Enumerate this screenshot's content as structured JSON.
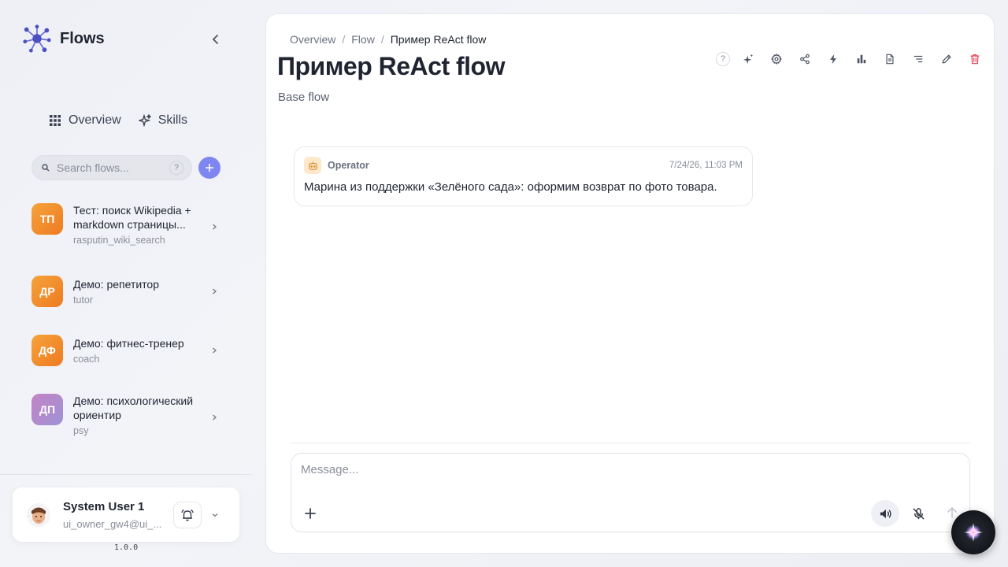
{
  "app": {
    "name": "Flows",
    "version": "1.0.0"
  },
  "nav": {
    "tabs": [
      {
        "label": "Overview",
        "icon": "grid-icon"
      },
      {
        "label": "Skills",
        "icon": "sparkles-icon"
      }
    ]
  },
  "search": {
    "placeholder": "Search flows...",
    "help": "?"
  },
  "flows": [
    {
      "initials": "ТП",
      "title": "Тест: поиск Wikipedia + markdown страницы...",
      "slug": "rasputin_wiki_search",
      "color": "#f08a2c"
    },
    {
      "initials": "ДР",
      "title": "Демо: репетитор",
      "slug": "tutor",
      "color": "#f08a2c"
    },
    {
      "initials": "ДФ",
      "title": "Демо: фитнес-тренер",
      "slug": "coach",
      "color": "#f08a2c"
    },
    {
      "initials": "ДП",
      "title": "Демо: психологический ориентир",
      "slug": "psy",
      "color": "#b589c9"
    }
  ],
  "user": {
    "name": "System User 1",
    "email": "ui_owner_gw4@ui_..."
  },
  "breadcrumb": {
    "items": [
      "Overview",
      "Flow"
    ],
    "separator": "/",
    "current": "Пример ReAct flow"
  },
  "page": {
    "title": "Пример ReAct flow",
    "subtitle": "Base flow"
  },
  "toolbar": {
    "help": "?",
    "icons": [
      "ai-sparkle-icon",
      "settings-gear-icon",
      "share-icon",
      "lightning-icon",
      "bar-chart-icon",
      "document-icon",
      "list-icon",
      "edit-pencil-icon",
      "trash-icon"
    ]
  },
  "messages": [
    {
      "author": "Operator",
      "time": "7/24/26, 11:03 PM",
      "text": "Марина из поддержки «Зелёного сада»: оформим возврат по фото товара."
    }
  ],
  "composer": {
    "placeholder": "Message..."
  },
  "colors": {
    "accent": "#7f86f0",
    "danger": "#e53e52",
    "brand_logo": "#5b5fcf"
  }
}
